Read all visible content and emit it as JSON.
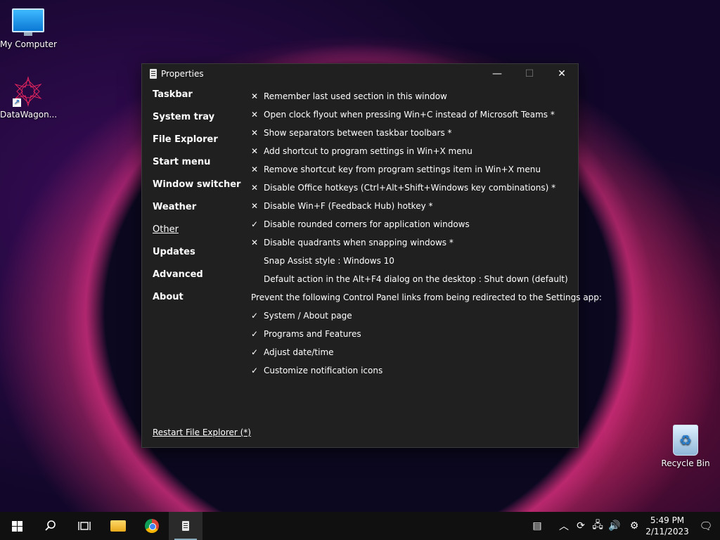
{
  "desktop": {
    "icons": [
      {
        "label": "My Computer",
        "icon": "monitor-icon"
      },
      {
        "label": "DataWagon...",
        "icon": "datawagon-icon"
      },
      {
        "label": "Recycle Bin",
        "icon": "recycle-bin-icon"
      }
    ]
  },
  "window": {
    "title": "Properties",
    "controls": {
      "minimize": "—",
      "maximize": "☐",
      "close": "✕"
    },
    "nav": [
      {
        "label": "Taskbar"
      },
      {
        "label": "System tray"
      },
      {
        "label": "File Explorer"
      },
      {
        "label": "Start menu"
      },
      {
        "label": "Window switcher"
      },
      {
        "label": "Weather"
      },
      {
        "label": "Other",
        "active": true
      },
      {
        "label": "Updates"
      },
      {
        "label": "Advanced"
      },
      {
        "label": "About"
      }
    ],
    "options": [
      {
        "mark": "✕",
        "label": "Remember last used section in this window"
      },
      {
        "mark": "✕",
        "label": "Open clock flyout when pressing Win+C instead of Microsoft Teams *"
      },
      {
        "mark": "✕",
        "label": "Show separators between taskbar toolbars *"
      },
      {
        "mark": "✕",
        "label": "Add shortcut to program settings in Win+X menu"
      },
      {
        "mark": "✕",
        "label": "Remove shortcut key from program settings item in Win+X menu"
      },
      {
        "mark": "✕",
        "label": "Disable Office hotkeys (Ctrl+Alt+Shift+Windows key combinations) *"
      },
      {
        "mark": "✕",
        "label": "Disable Win+F (Feedback Hub) hotkey *"
      },
      {
        "mark": "✓",
        "label": "Disable rounded corners for application windows"
      },
      {
        "mark": "✕",
        "label": "Disable quadrants when snapping windows *"
      },
      {
        "mark": "",
        "label": "Snap Assist style : Windows 10"
      },
      {
        "mark": "",
        "label": "Default action in the Alt+F4 dialog on the desktop : Shut down (default)"
      },
      {
        "heading": true,
        "label": "Prevent the following Control Panel links from being redirected to the Settings app:"
      },
      {
        "mark": "✓",
        "label": "System / About page"
      },
      {
        "mark": "✓",
        "label": "Programs and Features"
      },
      {
        "mark": "✓",
        "label": "Adjust date/time"
      },
      {
        "mark": "✓",
        "label": "Customize notification icons"
      }
    ],
    "restart_link": "Restart File Explorer (*)"
  },
  "taskbar": {
    "clock_time": "5:49 PM",
    "clock_date": "2/11/2023",
    "tray_chevron": "︿",
    "tray_settings": "⚙",
    "notification": "🗨"
  }
}
